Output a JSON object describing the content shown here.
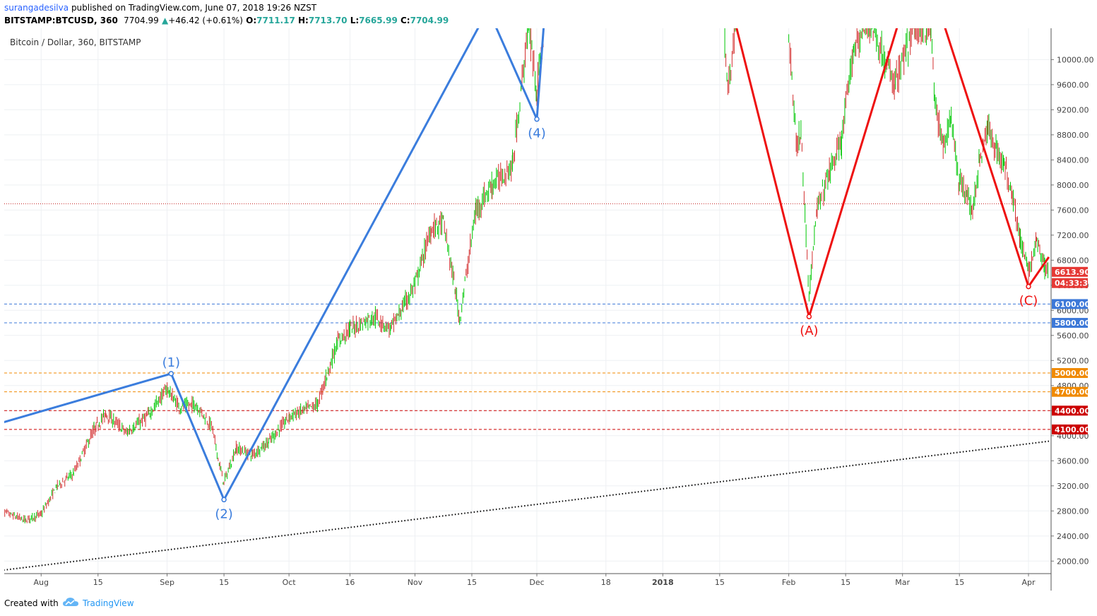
{
  "header": {
    "author": "surangadesilva",
    "published": "published on TradingView.com, June 07, 2018 19:26 NZST",
    "symbol": "BITSTAMP:BTCUSD, 360",
    "last": "7704.99",
    "change": "+46.42 (+0.61%)",
    "o_label": "O:",
    "o_value": "7711.17",
    "h_label": "H:",
    "h_value": "7713.70",
    "l_label": "L:",
    "l_value": "7665.99",
    "c_label": "C:",
    "c_value": "7704.99"
  },
  "chart_title": "Bitcoin / Dollar, 360, BITSTAMP",
  "footer": {
    "created": "Created with",
    "brand": "TradingView"
  },
  "colors": {
    "up": "#00c805",
    "down": "#d32f2f",
    "wave_blue": "#3b7ddd",
    "wave_red": "#ee1111",
    "support_blue": "#3c78d8",
    "orange": "#f08a00",
    "red_dash": "#cc0000",
    "price_line": "#c62828"
  },
  "chart_data": {
    "type": "candlestick",
    "y_axis": {
      "min": 1800,
      "max": 10500,
      "scale": "linear",
      "position": "right",
      "ticks": [
        "2000.00",
        "2400.00",
        "2800.00",
        "3200.00",
        "3600.00",
        "4000.00",
        "4400.00",
        "4800.00",
        "5200.00",
        "5600.00",
        "6000.00",
        "6400.00",
        "6800.00",
        "7200.00",
        "7600.00",
        "8000.00",
        "8400.00",
        "8800.00",
        "9200.00",
        "9600.00",
        "10000.00"
      ]
    },
    "x_axis": {
      "ticks": [
        "Aug",
        "15",
        "Sep",
        "15",
        "Oct",
        "16",
        "Nov",
        "15",
        "Dec",
        "18",
        "2018",
        "15",
        "Feb",
        "15",
        "Mar",
        "15",
        "Apr"
      ]
    },
    "grid": true,
    "price_labels": [
      {
        "text": "6613.90",
        "value": 6614,
        "color": "#e53935"
      },
      {
        "text": "04:33:31",
        "value": 6435,
        "color": "#e53935"
      },
      {
        "text": "6100.00",
        "value": 6100,
        "color": "#3c78d8"
      },
      {
        "text": "5800.00",
        "value": 5800,
        "color": "#3c78d8"
      },
      {
        "text": "5000.00",
        "value": 5000,
        "color": "#f08a00"
      },
      {
        "text": "4700.00",
        "value": 4700,
        "color": "#f08a00"
      },
      {
        "text": "4400.00",
        "value": 4400,
        "color": "#cc0000"
      },
      {
        "text": "4100.00",
        "value": 4100,
        "color": "#cc0000"
      }
    ],
    "horizontal_levels": [
      {
        "value": 7700,
        "style": "dotted",
        "color": "#c62828"
      },
      {
        "value": 6100,
        "style": "dashed",
        "color": "#3c78d8"
      },
      {
        "value": 5800,
        "style": "dashed",
        "color": "#3c78d8"
      },
      {
        "value": 5000,
        "style": "dashed",
        "color": "#f08a00"
      },
      {
        "value": 4700,
        "style": "dashed",
        "color": "#f08a00"
      },
      {
        "value": 4400,
        "style": "dashed",
        "color": "#cc0000"
      },
      {
        "value": 4100,
        "style": "dashed",
        "color": "#cc0000"
      }
    ],
    "trendline": {
      "style": "dotted",
      "color": "#000000",
      "from": {
        "date": "2017-07-22",
        "value": 1850
      },
      "to": {
        "date": "2018-04-12",
        "value": 3960
      }
    },
    "wave_labels": [
      "(1)",
      "(2)",
      "(4)",
      "(A)",
      "(C)"
    ],
    "impulse_wave": [
      {
        "date": "2017-07-22",
        "value": 4200
      },
      {
        "date": "2017-09-02",
        "value": 4990,
        "label": "(1)"
      },
      {
        "date": "2017-09-15",
        "value": 2980,
        "label": "(2)"
      },
      {
        "date": "2017-11-19",
        "value": 10800
      },
      {
        "date": "2017-12-01",
        "value": 9050,
        "label": "(4)"
      },
      {
        "date": "2017-12-03",
        "value": 10800
      }
    ],
    "corrective_wave": [
      {
        "date": "2018-01-18",
        "value": 10800
      },
      {
        "date": "2018-02-06",
        "value": 5900,
        "label": "(A)"
      },
      {
        "date": "2018-03-01",
        "value": 10800
      },
      {
        "date": "2018-03-10",
        "value": 10800
      },
      {
        "date": "2018-04-01",
        "value": 6380,
        "label": "(C)"
      },
      {
        "date": "2018-04-06",
        "value": 6850
      }
    ],
    "price_path": [
      {
        "date": "2017-07-22",
        "value": 2800
      },
      {
        "date": "2017-07-28",
        "value": 2650
      },
      {
        "date": "2017-08-01",
        "value": 2750
      },
      {
        "date": "2017-08-05",
        "value": 3200
      },
      {
        "date": "2017-08-09",
        "value": 3400
      },
      {
        "date": "2017-08-14",
        "value": 4100
      },
      {
        "date": "2017-08-17",
        "value": 4350
      },
      {
        "date": "2017-08-22",
        "value": 4050
      },
      {
        "date": "2017-08-27",
        "value": 4300
      },
      {
        "date": "2017-09-01",
        "value": 4750
      },
      {
        "date": "2017-09-04",
        "value": 4450
      },
      {
        "date": "2017-09-08",
        "value": 4500
      },
      {
        "date": "2017-09-12",
        "value": 4150
      },
      {
        "date": "2017-09-14",
        "value": 3500
      },
      {
        "date": "2017-09-15",
        "value": 3250
      },
      {
        "date": "2017-09-18",
        "value": 3800
      },
      {
        "date": "2017-09-22",
        "value": 3700
      },
      {
        "date": "2017-09-26",
        "value": 3900
      },
      {
        "date": "2017-10-01",
        "value": 4300
      },
      {
        "date": "2017-10-08",
        "value": 4500
      },
      {
        "date": "2017-10-13",
        "value": 5500
      },
      {
        "date": "2017-10-16",
        "value": 5700
      },
      {
        "date": "2017-10-22",
        "value": 5900
      },
      {
        "date": "2017-10-26",
        "value": 5700
      },
      {
        "date": "2017-11-01",
        "value": 6400
      },
      {
        "date": "2017-11-05",
        "value": 7300
      },
      {
        "date": "2017-11-08",
        "value": 7400
      },
      {
        "date": "2017-11-11",
        "value": 6300
      },
      {
        "date": "2017-11-12",
        "value": 5850
      },
      {
        "date": "2017-11-16",
        "value": 7600
      },
      {
        "date": "2017-11-20",
        "value": 8000
      },
      {
        "date": "2017-11-25",
        "value": 8300
      },
      {
        "date": "2017-11-29",
        "value": 10600
      },
      {
        "date": "2017-12-01",
        "value": 9500
      },
      {
        "date": "2017-12-03",
        "value": 10600
      },
      {
        "date": "2018-01-16",
        "value": 10500
      },
      {
        "date": "2018-01-17",
        "value": 9500
      },
      {
        "date": "2018-01-19",
        "value": 10600
      },
      {
        "date": "2018-02-01",
        "value": 10400
      },
      {
        "date": "2018-02-03",
        "value": 8600
      },
      {
        "date": "2018-02-04",
        "value": 8900
      },
      {
        "date": "2018-02-05",
        "value": 7500
      },
      {
        "date": "2018-02-06",
        "value": 6300
      },
      {
        "date": "2018-02-08",
        "value": 7600
      },
      {
        "date": "2018-02-11",
        "value": 8200
      },
      {
        "date": "2018-02-14",
        "value": 8700
      },
      {
        "date": "2018-02-17",
        "value": 10200
      },
      {
        "date": "2018-02-21",
        "value": 10600
      },
      {
        "date": "2018-02-27",
        "value": 9600
      },
      {
        "date": "2018-03-04",
        "value": 10500
      },
      {
        "date": "2018-03-08",
        "value": 10500
      },
      {
        "date": "2018-03-09",
        "value": 9300
      },
      {
        "date": "2018-03-11",
        "value": 8600
      },
      {
        "date": "2018-03-13",
        "value": 9100
      },
      {
        "date": "2018-03-15",
        "value": 8000
      },
      {
        "date": "2018-03-17",
        "value": 7900
      },
      {
        "date": "2018-03-18",
        "value": 7500
      },
      {
        "date": "2018-03-20",
        "value": 8400
      },
      {
        "date": "2018-03-22",
        "value": 8900
      },
      {
        "date": "2018-03-24",
        "value": 8600
      },
      {
        "date": "2018-03-26",
        "value": 8300
      },
      {
        "date": "2018-03-28",
        "value": 7900
      },
      {
        "date": "2018-03-30",
        "value": 7100
      },
      {
        "date": "2018-04-01",
        "value": 6600
      },
      {
        "date": "2018-04-03",
        "value": 7100
      },
      {
        "date": "2018-04-05",
        "value": 6700
      },
      {
        "date": "2018-04-06",
        "value": 6614
      }
    ]
  }
}
